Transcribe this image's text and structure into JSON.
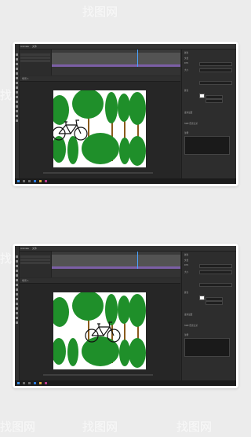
{
  "watermark": {
    "text": "找图网"
  },
  "app": {
    "menu": [
      "Animate",
      "文件",
      "编辑",
      "视图",
      "插入",
      "修改",
      "文本",
      "命令",
      "控制",
      "调试",
      "窗口",
      "帮助"
    ],
    "doc_tab": "场景 1",
    "timeline": {
      "layers": [
        "图层 1",
        "图层 2",
        "图层 3"
      ]
    },
    "properties": {
      "tab": "属性",
      "section_doc": "文档",
      "fps_label": "FPS",
      "size_label": "大小",
      "stage_label": "舞台",
      "publish_label": "发布设置",
      "swf_label": "SWF 历史记录",
      "notes_label": "注释"
    },
    "taskbar": {
      "icons": [
        "windows-icon",
        "search-icon",
        "taskview-icon",
        "edge-icon",
        "explorer-icon",
        "animate-icon"
      ]
    }
  },
  "colors": {
    "tree_green": "#1f8f2a",
    "trunk": "#8a5a1c",
    "timeline_purple": "#7c5fa6",
    "playhead": "#4aa3ff"
  }
}
